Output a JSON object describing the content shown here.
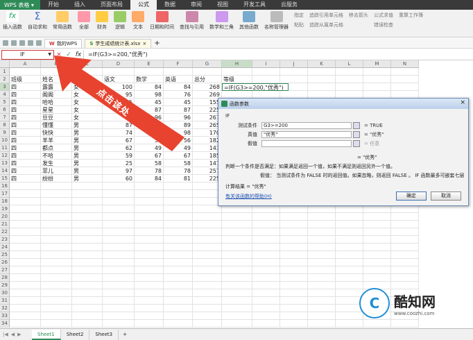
{
  "app": {
    "name": "WPS 表格"
  },
  "menu_tabs": [
    "开始",
    "插入",
    "页面布局",
    "公式",
    "数据",
    "审阅",
    "视图",
    "开发工具",
    "云服务"
  ],
  "active_tab": "公式",
  "ribbon": {
    "buttons": [
      "插入函数",
      "自动求和",
      "常用函数",
      "全部",
      "财务",
      "逻辑",
      "文本",
      "日期和时间",
      "查找与引用",
      "数学和三角",
      "其他函数",
      "名称管理器"
    ],
    "small_items": [
      "指定",
      "粘贴",
      "追踪引用单元格",
      "追踪从属单元格",
      "移去箭头",
      "公式求值",
      "错误检查",
      "重算工作簿"
    ]
  },
  "doc_tabs": [
    "我的WPS",
    "学生成绩统计表.xlsx"
  ],
  "formula_bar": {
    "name_box": "IF",
    "cancel": "×",
    "confirm": "✓",
    "fx": "fx",
    "formula": "=IF(G3>=200,\"优秀\")"
  },
  "columns": [
    "A",
    "B",
    "C",
    "D",
    "E",
    "F",
    "G",
    "H",
    "I",
    "J",
    "K",
    "L",
    "M",
    "N"
  ],
  "header_row": [
    "班级",
    "姓名",
    "性别",
    "语文",
    "数学",
    "英语",
    "总分",
    "等级"
  ],
  "rows": [
    [
      "四",
      "露露",
      "女",
      "100",
      "84",
      "84",
      "268"
    ],
    [
      "四",
      "阁阁",
      "女",
      "95",
      "98",
      "76",
      "269"
    ],
    [
      "四",
      "哈哈",
      "女",
      "65",
      "45",
      "45",
      "155"
    ],
    [
      "四",
      "星星",
      "女",
      "87",
      "87",
      "87",
      "225"
    ],
    [
      "四",
      "豆豆",
      "女",
      "93",
      "96",
      "96",
      "267"
    ],
    [
      "四",
      "懂懂",
      "男",
      "87",
      "89",
      "89",
      "265"
    ],
    [
      "四",
      "快快",
      "男",
      "74",
      "98",
      "98",
      "170"
    ],
    [
      "四",
      "羊羊",
      "男",
      "67",
      "56",
      "56",
      "182"
    ],
    [
      "四",
      "都点",
      "男",
      "62",
      "49",
      "49",
      "143"
    ],
    [
      "四",
      "不哈",
      "男",
      "59",
      "67",
      "67",
      "185"
    ],
    [
      "四",
      "发生",
      "男",
      "25",
      "58",
      "58",
      "147"
    ],
    [
      "四",
      "菲儿",
      "男",
      "97",
      "78",
      "78",
      "257"
    ],
    [
      "四",
      "纷纷",
      "男",
      "60",
      "84",
      "81",
      "225"
    ]
  ],
  "active_cell_formula": "=IF(G3>=200,\"优秀\")",
  "row_numbers": [
    "1",
    "2",
    "3",
    "4",
    "5",
    "6",
    "7",
    "8",
    "9",
    "10",
    "11",
    "12",
    "13",
    "14",
    "15",
    "16",
    "17",
    "18",
    "19",
    "20",
    "21",
    "22",
    "23",
    "24",
    "25",
    "26",
    "27",
    "28",
    "29",
    "30",
    "31",
    "32",
    "33",
    "34"
  ],
  "annotation": {
    "text": "点击该处",
    "color": "#e8432f"
  },
  "dialog": {
    "title": "函数参数",
    "func": "IF",
    "args": [
      {
        "label": "测试条件",
        "value": "G3>=200",
        "result": "= TRUE"
      },
      {
        "label": "真值",
        "value": "\"优秀\"",
        "result": "= \"优秀\""
      },
      {
        "label": "假值",
        "value": "",
        "result": "= 任意"
      }
    ],
    "overall_result": "= \"优秀\"",
    "description": "判断一个条件是否满足：如果满足返回一个值，如果不满足则返回另外一个值。",
    "arg_help_label": "假值：",
    "arg_help": "当测试条件为 FALSE 时的返回值。如果忽略，则返回 FALSE 。 IF 函数最多可嵌套七层",
    "calc_result": "计算结果 = \"优秀\"",
    "help_link": "有关该函数的帮助(H)",
    "ok": "确定",
    "cancel": "取消"
  },
  "sheets": [
    "Sheet1",
    "Sheet2",
    "Sheet3"
  ],
  "sheet_add": "+",
  "watermark": {
    "name": "酷知网",
    "url": "www.coozhi.com",
    "logo": "C"
  },
  "colors": {
    "brand": "#2e8b57",
    "arrow": "#e8432f"
  }
}
